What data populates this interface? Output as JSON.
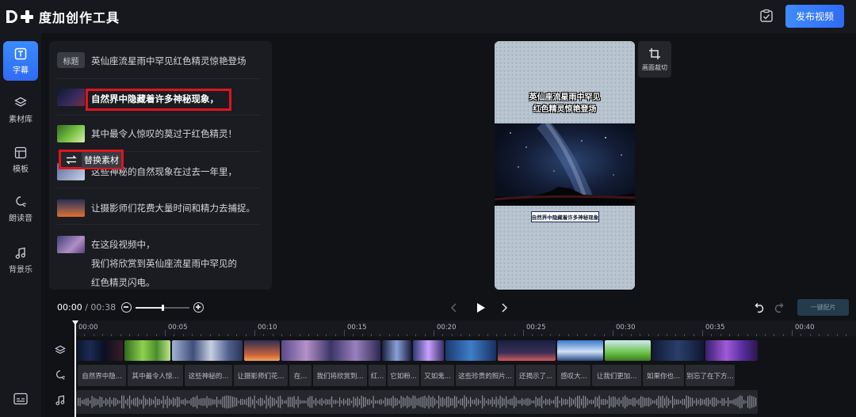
{
  "app": {
    "name": "度加创作工具",
    "publish_label": "发布视频"
  },
  "nav": [
    {
      "label": "字幕",
      "icon": "text-icon",
      "active": true
    },
    {
      "label": "素材库",
      "icon": "layers-icon",
      "active": false
    },
    {
      "label": "模板",
      "icon": "template-icon",
      "active": false
    },
    {
      "label": "朗读音",
      "icon": "voice-icon",
      "active": false
    },
    {
      "label": "背景乐",
      "icon": "music-icon",
      "active": false
    }
  ],
  "subtitles": {
    "title_tag": "标题",
    "title_text": "英仙座流星雨中罕见红色精灵惊艳登场",
    "items": [
      {
        "text": "自然界中隐藏着许多神秘现象，"
      },
      {
        "text": "其中最令人惊叹的莫过于红色精灵！"
      },
      {
        "text": "这些神秘的自然现象在过去一年里，",
        "visible_text": "这些神秘的自然现象在过去一年里，"
      },
      {
        "text": "让摄影师们花费大量时间和精力去捕捉。"
      },
      {
        "text_lines": [
          "在这段视频中，",
          "我们将欣赏到英仙座流星雨中罕见的",
          "红色精灵闪电。"
        ]
      }
    ],
    "replace_label": "替换素材"
  },
  "preview": {
    "title_lines": [
      "英仙座流星雨中罕见",
      "红色精灵惊艳登场"
    ],
    "caption": "自然界中隐藏着许多神秘现象",
    "crop_label": "画面裁切"
  },
  "timeline": {
    "current_time": "00:00",
    "total_time": "/ 00:38",
    "zoom_level": 0.5,
    "match_label": "一键配片",
    "ticks": [
      "00:00",
      "00:05",
      "00:10",
      "00:15",
      "00:20",
      "00:25",
      "00:30",
      "00:35",
      "00:40"
    ],
    "subtitle_clips": [
      "自然界中隐...",
      "其中最令人惊...",
      "这些神秘的...",
      "让摄影师们花...",
      "在...",
      "我们将欣赏到...",
      "红...",
      "它如粉...",
      "又如鬼...",
      "这些珍贵的照片...",
      "还揭示了...",
      "感叹大...",
      "让我们更加...",
      "如果你也...",
      "别忘了在下方..."
    ]
  },
  "colors": {
    "accent": "#2f6bf5",
    "highlight": "#e0141e"
  }
}
